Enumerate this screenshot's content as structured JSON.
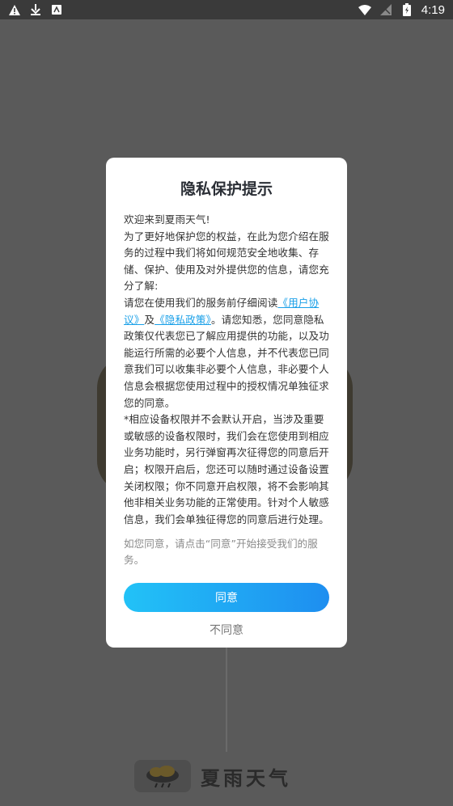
{
  "status_bar": {
    "time": "4:19",
    "icons_left": [
      "warning-icon",
      "download-icon",
      "app-notification-icon"
    ],
    "icons_right": [
      "wifi-icon",
      "no-sim-icon",
      "battery-charging-icon"
    ]
  },
  "background_app": {
    "brand_name": "夏雨天气",
    "logo_icon": "cloud-rain-icon"
  },
  "dialog": {
    "title": "隐私保护提示",
    "paragraphs": {
      "p1": "欢迎来到夏雨天气!",
      "p2": "为了更好地保护您的权益，在此为您介绍在服务的过程中我们将如何规范安全地收集、存储、保护、使用及对外提供您的信息，请您充分了解:",
      "p3_before": "请您在使用我们的服务前仔细阅读",
      "link_user_agreement": "《用户协议》",
      "p3_and": "及",
      "link_privacy_policy": "《隐私政策》",
      "p3_after": "。请您知悉，您同意隐私政策仅代表您已了解应用提供的功能，以及功能运行所需的必要个人信息，并不代表您已同意我们可以收集非必要个人信息，非必要个人信息会根据您使用过程中的授权情况单独征求您的同意。",
      "p4": "*相应设备权限并不会默认开启，当涉及重要或敏感的设备权限时，我们会在您使用到相应业务功能时，另行弹窗再次征得您的同意后开启；权限开启后，您还可以随时通过设备设置关闭权限；你不同意开启权限，将不会影响其他非相关业务功能的正常使用。针对个人敏感信息，我们会单独征得您的同意后进行处理。"
    },
    "footnote": "如您同意，请点击“同意”开始接受我们的服务。",
    "agree_label": "同意",
    "disagree_label": "不同意"
  },
  "colors": {
    "overlay": "#5a5a5a",
    "link": "#1aa0e8",
    "button_gradient_start": "#22c2f7",
    "button_gradient_end": "#1e8ef0"
  }
}
